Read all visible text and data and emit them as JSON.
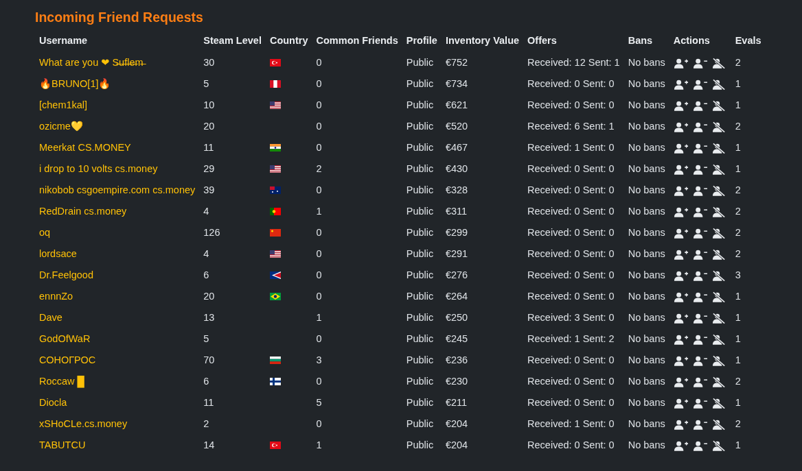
{
  "title": "Incoming Friend Requests",
  "table": {
    "columns": [
      "Username",
      "Steam Level",
      "Country",
      "Common Friends",
      "Profile",
      "Inventory Value",
      "Offers",
      "Bans",
      "Actions",
      "Evals"
    ],
    "rows": [
      {
        "username": "What are you ❤ S̶u̶f̶l̶e̶m̶",
        "level": "30",
        "country": {
          "kind": "tr"
        },
        "common": "0",
        "profile": "Public",
        "value": "€752",
        "offers": "Received: 12 Sent: 1",
        "bans": "No bans",
        "evals": "2"
      },
      {
        "username": "🔥BRUNO[1]🔥",
        "level": "5",
        "country": {
          "kind": "pe"
        },
        "common": "0",
        "profile": "Public",
        "value": "€734",
        "offers": "Received: 0 Sent: 0",
        "bans": "No bans",
        "evals": "1"
      },
      {
        "username": "[chem1kal]",
        "level": "10",
        "country": {
          "kind": "us"
        },
        "common": "0",
        "profile": "Public",
        "value": "€621",
        "offers": "Received: 0 Sent: 0",
        "bans": "No bans",
        "evals": "1"
      },
      {
        "username": "ozicme💛",
        "level": "20",
        "common": "0",
        "profile": "Public",
        "value": "€520",
        "offers": "Received: 6 Sent: 1",
        "bans": "No bans",
        "evals": "2"
      },
      {
        "username": "Meerkat CS.MONEY",
        "level": "11",
        "country": {
          "kind": "in"
        },
        "common": "0",
        "profile": "Public",
        "value": "€467",
        "offers": "Received: 1 Sent: 0",
        "bans": "No bans",
        "evals": "1"
      },
      {
        "username": "i drop to 10 volts cs.money",
        "level": "29",
        "country": {
          "kind": "us"
        },
        "common": "2",
        "profile": "Public",
        "value": "€430",
        "offers": "Received: 0 Sent: 0",
        "bans": "No bans",
        "evals": "1"
      },
      {
        "username": "nikobob csgoempire.com cs.money",
        "level": "39",
        "country": {
          "kind": "au"
        },
        "common": "0",
        "profile": "Public",
        "value": "€328",
        "offers": "Received: 0 Sent: 0",
        "bans": "No bans",
        "evals": "2"
      },
      {
        "username": "RedDrain cs.money",
        "level": "4",
        "country": {
          "kind": "pt"
        },
        "common": "1",
        "profile": "Public",
        "value": "€311",
        "offers": "Received: 0 Sent: 0",
        "bans": "No bans",
        "evals": "2"
      },
      {
        "username": "oq",
        "level": "126",
        "country": {
          "kind": "cn"
        },
        "common": "0",
        "profile": "Public",
        "value": "€299",
        "offers": "Received: 0 Sent: 0",
        "bans": "No bans",
        "evals": "2"
      },
      {
        "username": "lordsace",
        "level": "4",
        "country": {
          "kind": "us"
        },
        "common": "0",
        "profile": "Public",
        "value": "€291",
        "offers": "Received: 0 Sent: 0",
        "bans": "No bans",
        "evals": "2"
      },
      {
        "username": "Dr.Feelgood",
        "level": "6",
        "country": {
          "kind": "as"
        },
        "common": "0",
        "profile": "Public",
        "value": "€276",
        "offers": "Received: 0 Sent: 0",
        "bans": "No bans",
        "evals": "3"
      },
      {
        "username": "ennnZo",
        "level": "20",
        "country": {
          "kind": "br"
        },
        "common": "0",
        "profile": "Public",
        "value": "€264",
        "offers": "Received: 0 Sent: 0",
        "bans": "No bans",
        "evals": "1"
      },
      {
        "username": "Dave",
        "level": "13",
        "common": "1",
        "profile": "Public",
        "value": "€250",
        "offers": "Received: 3 Sent: 0",
        "bans": "No bans",
        "evals": "1"
      },
      {
        "username": "GodOfWaR",
        "level": "5",
        "common": "0",
        "profile": "Public",
        "value": "€245",
        "offers": "Received: 1 Sent: 2",
        "bans": "No bans",
        "evals": "1"
      },
      {
        "username": "СОНОГРОС",
        "level": "70",
        "country": {
          "kind": "bg"
        },
        "common": "3",
        "profile": "Public",
        "value": "€236",
        "offers": "Received: 0 Sent: 0",
        "bans": "No bans",
        "evals": "1"
      },
      {
        "username": "Roccaw █",
        "level": "6",
        "country": {
          "kind": "fi"
        },
        "common": "0",
        "profile": "Public",
        "value": "€230",
        "offers": "Received: 0 Sent: 0",
        "bans": "No bans",
        "evals": "2"
      },
      {
        "username": "Diocla",
        "level": "11",
        "common": "5",
        "profile": "Public",
        "value": "€211",
        "offers": "Received: 0 Sent: 0",
        "bans": "No bans",
        "evals": "1"
      },
      {
        "username": "xSHoCLe.cs.money",
        "level": "2",
        "common": "0",
        "profile": "Public",
        "value": "€204",
        "offers": "Received: 1 Sent: 0",
        "bans": "No bans",
        "evals": "2"
      },
      {
        "username": "TABUTCU",
        "level": "14",
        "country": {
          "kind": "tr"
        },
        "common": "1",
        "profile": "Public",
        "value": "€204",
        "offers": "Received: 0 Sent: 0",
        "bans": "No bans",
        "evals": "1"
      }
    ]
  }
}
